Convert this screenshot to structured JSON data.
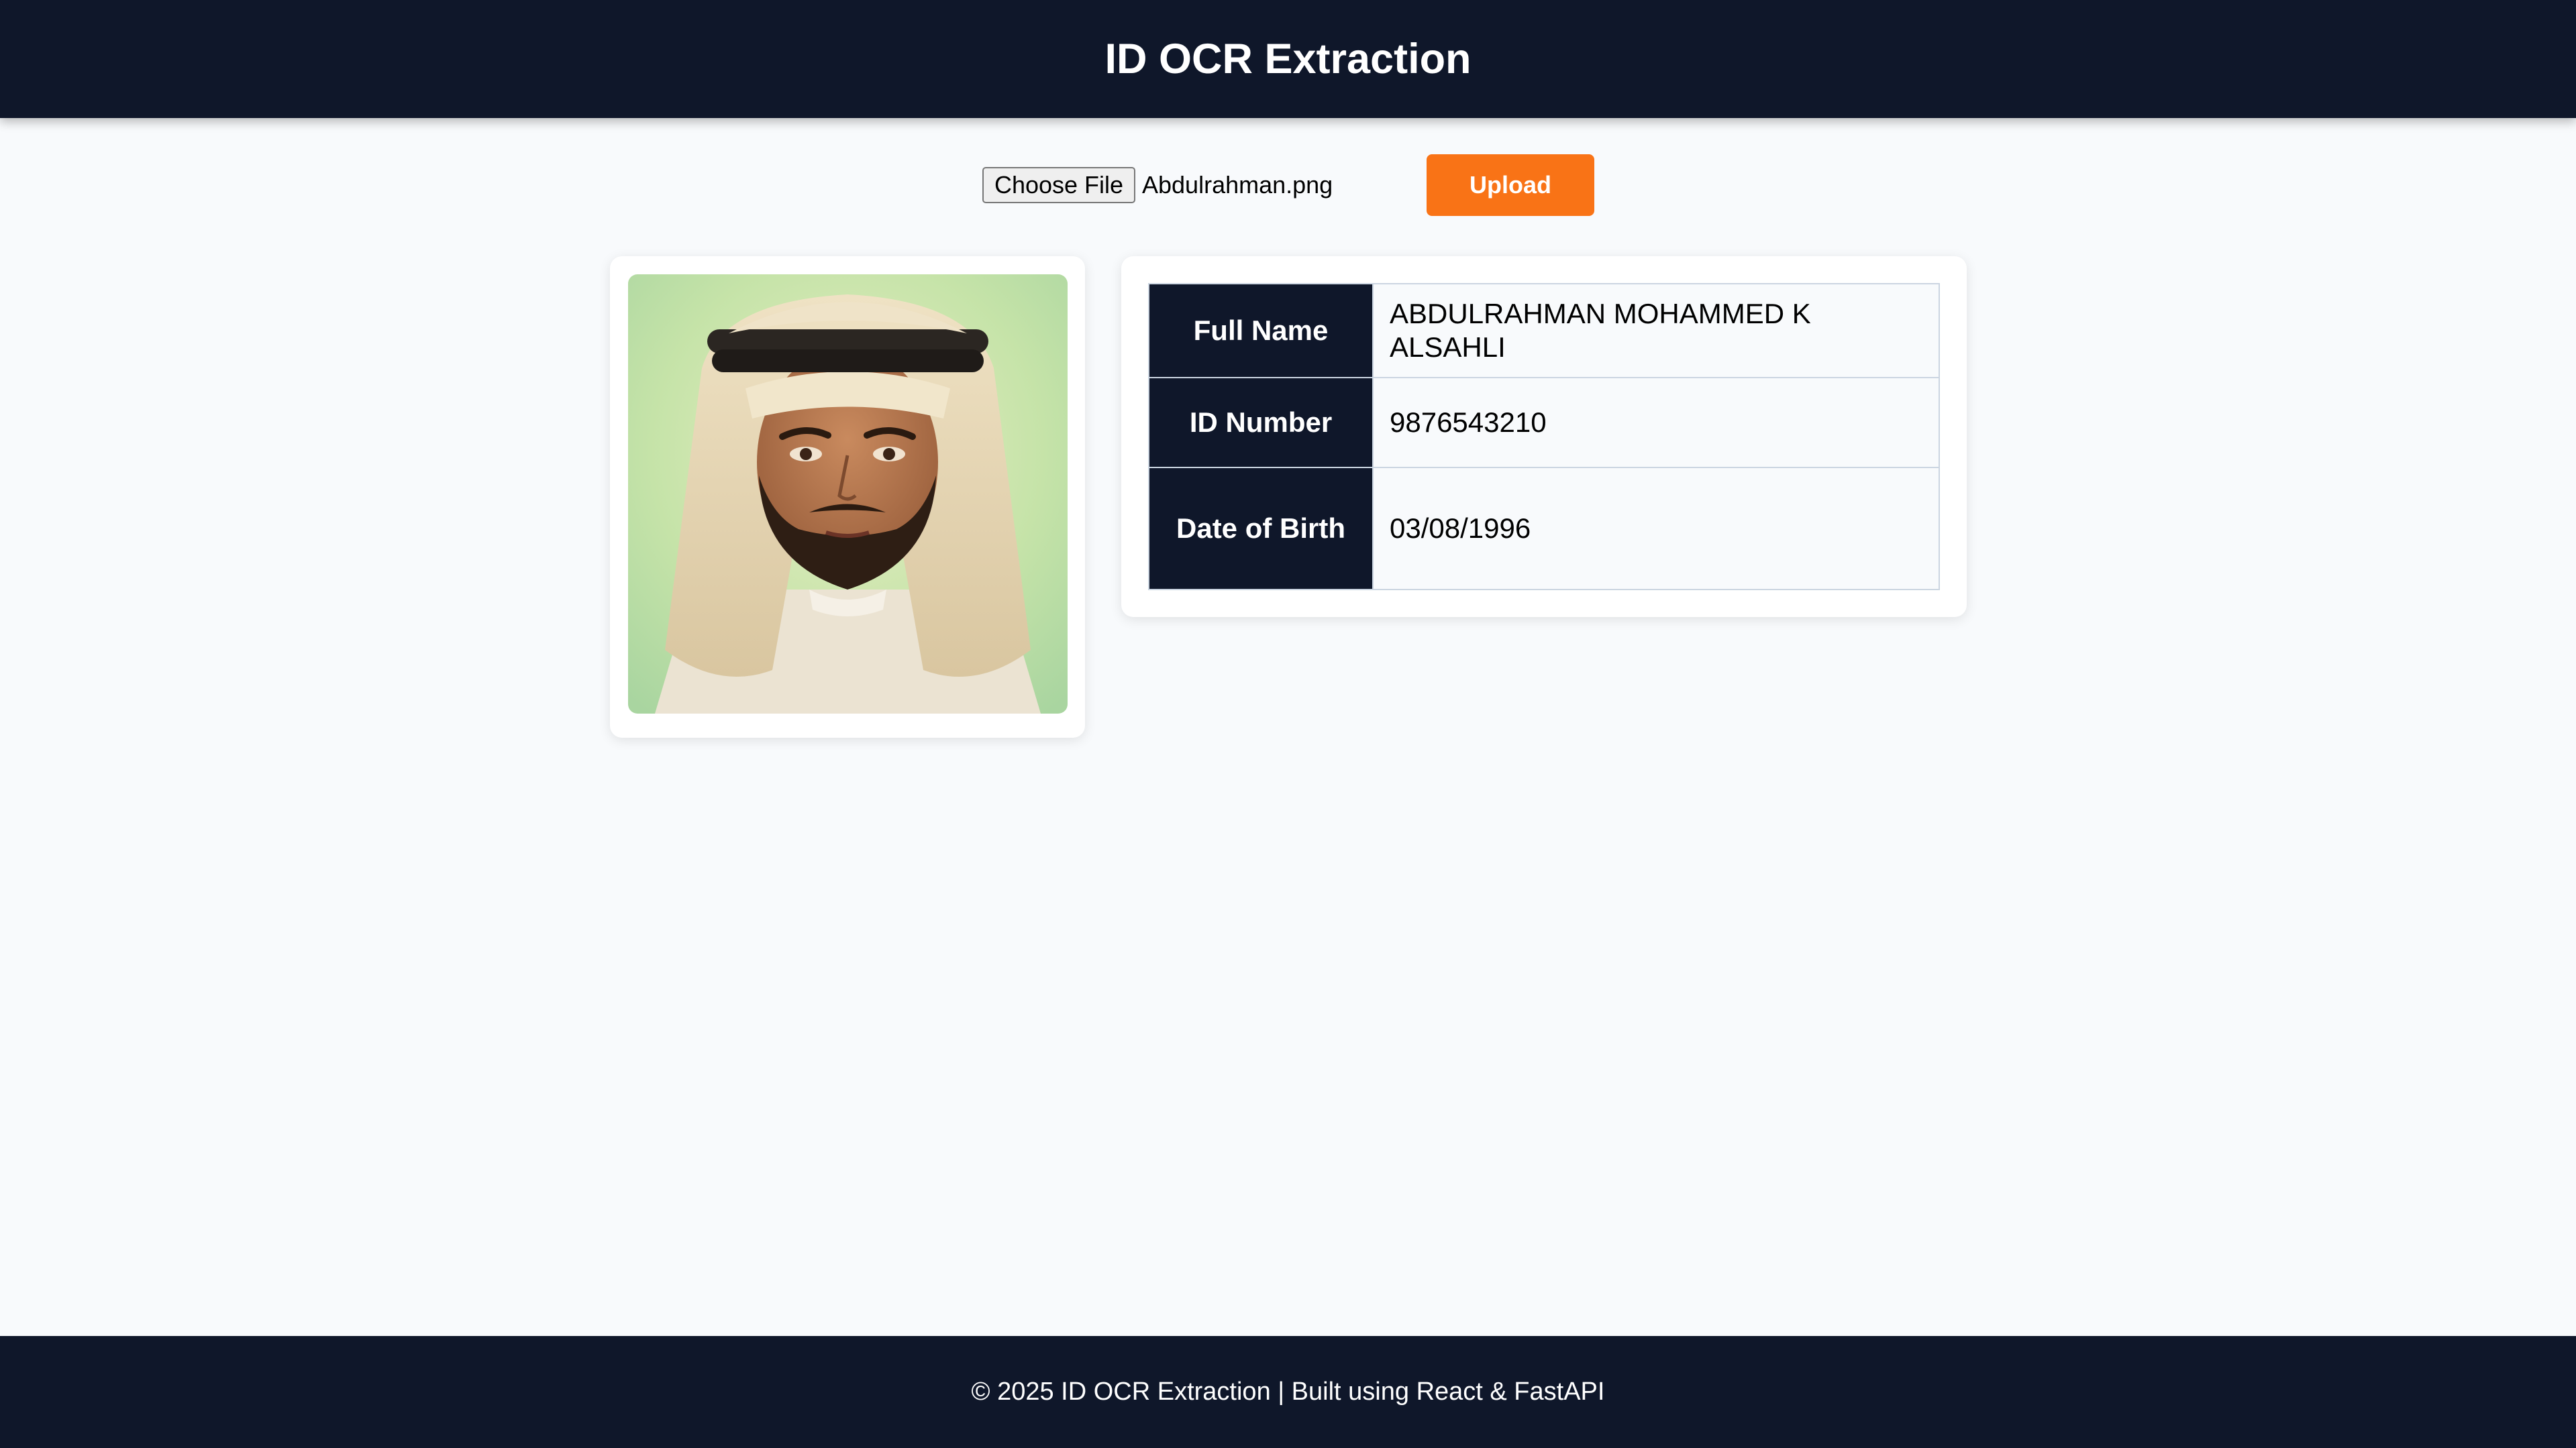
{
  "header": {
    "title": "ID OCR Extraction"
  },
  "upload": {
    "choose_file_label": "Choose File",
    "file_name": "Abdulrahman.png",
    "upload_label": "Upload",
    "accent_color": "#f97316"
  },
  "photo": {
    "alt": "Abdulrahman.png"
  },
  "results": {
    "rows": [
      {
        "label": "Full Name",
        "value": "ABDULRAHMAN MOHAMMED K ALSAHLI"
      },
      {
        "label": "ID Number",
        "value": "9876543210"
      },
      {
        "label": "Date of Birth",
        "value": "03/08/1996"
      }
    ]
  },
  "footer": {
    "text": "© 2025 ID OCR Extraction | Built using React & FastAPI"
  },
  "colors": {
    "navy": "#0f172a",
    "background": "#f8fafc",
    "accent": "#f97316"
  }
}
